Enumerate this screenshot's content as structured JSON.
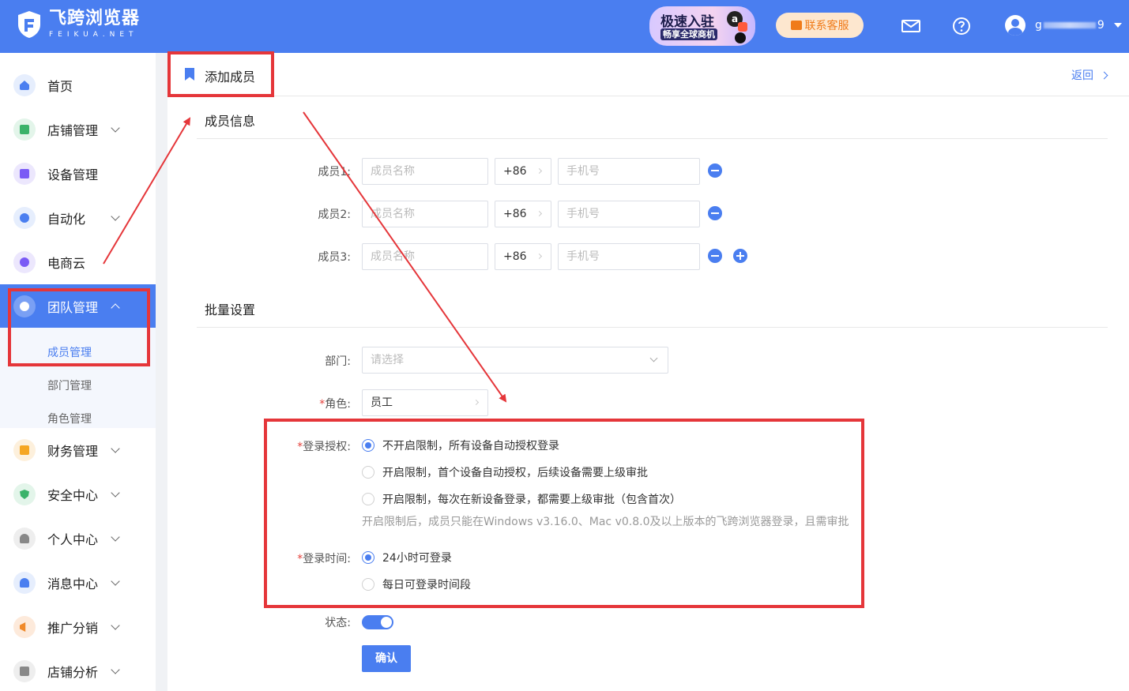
{
  "header": {
    "logo_title": "飞跨浏览器",
    "logo_sub": "FEIKUA.NET",
    "promo_line1": "极速入驻",
    "promo_line2": "畅享全球商机",
    "service_label": "联系客服",
    "username_prefix": "g",
    "username_suffix": "9"
  },
  "sidebar": {
    "items": [
      {
        "label": "首页",
        "color": "#4a7ef0",
        "bg": "#e6eefd"
      },
      {
        "label": "店铺管理",
        "color": "#3bb36a",
        "bg": "#e3f5ea"
      },
      {
        "label": "设备管理",
        "color": "#7a5af5",
        "bg": "#ece7fd"
      },
      {
        "label": "自动化",
        "color": "#4a7ef0",
        "bg": "#e6eefd"
      },
      {
        "label": "电商云",
        "color": "#7a5af5",
        "bg": "#ece7fd"
      },
      {
        "label": "团队管理",
        "color": "#ffffff",
        "bg": "#7aa0f4"
      },
      {
        "label": "财务管理",
        "color": "#f5a623",
        "bg": "#fdf0dc"
      },
      {
        "label": "安全中心",
        "color": "#3bb36a",
        "bg": "#e3f5ea"
      },
      {
        "label": "个人中心",
        "color": "#888888",
        "bg": "#eeeeee"
      },
      {
        "label": "消息中心",
        "color": "#4a7ef0",
        "bg": "#e6eefd"
      },
      {
        "label": "推广分销",
        "color": "#f08a2a",
        "bg": "#fdeadb"
      },
      {
        "label": "店铺分析",
        "color": "#888888",
        "bg": "#eeeeee"
      }
    ],
    "sub_items": [
      "成员管理",
      "部门管理",
      "角色管理"
    ]
  },
  "main": {
    "page_title": "添加成员",
    "back_label": "返回",
    "section_member": "成员信息",
    "members": [
      {
        "label": "成员1:",
        "name_placeholder": "成员名称",
        "code": "+86",
        "phone_placeholder": "手机号"
      },
      {
        "label": "成员2:",
        "name_placeholder": "成员名称",
        "code": "+86",
        "phone_placeholder": "手机号"
      },
      {
        "label": "成员3:",
        "name_placeholder": "成员名称",
        "code": "+86",
        "phone_placeholder": "手机号"
      }
    ],
    "section_batch": "批量设置",
    "dept_label": "部门:",
    "dept_placeholder": "请选择",
    "role_label": "角色:",
    "role_value": "员工",
    "login_auth_label": "登录授权:",
    "login_auth_options": [
      "不开启限制，所有设备自动授权登录",
      "开启限制，首个设备自动授权，后续设备需要上级审批",
      "开启限制，每次在新设备登录，都需要上级审批（包含首次）"
    ],
    "login_auth_hint": "开启限制后，成员只能在Windows v3.16.0、Mac v0.8.0及以上版本的飞跨浏览器登录，且需审批",
    "login_time_label": "登录时间:",
    "login_time_options": [
      "24小时可登录",
      "每日可登录时间段"
    ],
    "status_label": "状态:",
    "status_on": true,
    "confirm_label": "确认"
  }
}
